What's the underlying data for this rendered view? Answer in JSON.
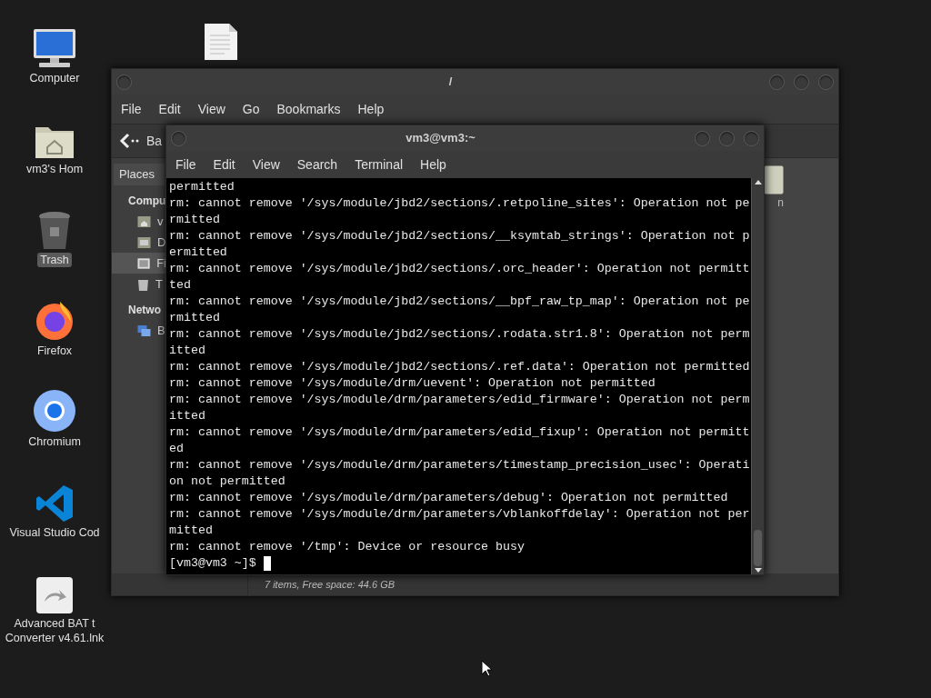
{
  "desktop_icons": [
    {
      "kind": "computer",
      "label": "Computer",
      "selected": false
    },
    {
      "kind": "home",
      "label": "vm3's Hom",
      "selected": false
    },
    {
      "kind": "trash",
      "label": "Trash",
      "selected": true
    },
    {
      "kind": "firefox",
      "label": "Firefox",
      "selected": false
    },
    {
      "kind": "chromium",
      "label": "Chromium",
      "selected": false
    },
    {
      "kind": "vscode",
      "label": "Visual Studio Cod",
      "selected": false
    },
    {
      "kind": "shortcut",
      "label": "Advanced BAT t\nConverter v4.61.lnk",
      "selected": false
    }
  ],
  "file_manager": {
    "title": "/",
    "menu": [
      "File",
      "Edit",
      "View",
      "Go",
      "Bookmarks",
      "Help"
    ],
    "back_button": "Ba",
    "sidebar_tab": "Places",
    "sections": [
      {
        "heading": "Compu",
        "items": [
          {
            "kind": "home",
            "label": "v",
            "selected": false
          },
          {
            "kind": "desktop",
            "label": "D",
            "selected": false
          },
          {
            "kind": "filesystem",
            "label": "Fi",
            "selected": true
          },
          {
            "kind": "trash",
            "label": "T",
            "selected": false
          }
        ]
      },
      {
        "heading": "Netwo",
        "items": [
          {
            "kind": "network",
            "label": "B",
            "selected": false
          }
        ]
      }
    ],
    "files": [
      {
        "label": "n"
      }
    ],
    "status": "7 items, Free space: 44.6 GB"
  },
  "terminal": {
    "title": "vm3@vm3:~",
    "menu": [
      "File",
      "Edit",
      "View",
      "Search",
      "Terminal",
      "Help"
    ],
    "lines": [
      "permitted",
      "rm: cannot remove '/sys/module/jbd2/sections/.retpoline_sites': Operation not pe",
      "rmitted",
      "rm: cannot remove '/sys/module/jbd2/sections/__ksymtab_strings': Operation not p",
      "ermitted",
      "rm: cannot remove '/sys/module/jbd2/sections/.orc_header': Operation not permitt",
      "ted",
      "rm: cannot remove '/sys/module/jbd2/sections/__bpf_raw_tp_map': Operation not pe",
      "rmitted",
      "rm: cannot remove '/sys/module/jbd2/sections/.rodata.str1.8': Operation not perm",
      "itted",
      "rm: cannot remove '/sys/module/jbd2/sections/.ref.data': Operation not permitted",
      "rm: cannot remove '/sys/module/drm/uevent': Operation not permitted",
      "rm: cannot remove '/sys/module/drm/parameters/edid_firmware': Operation not perm",
      "itted",
      "rm: cannot remove '/sys/module/drm/parameters/edid_fixup': Operation not permitt",
      "ed",
      "rm: cannot remove '/sys/module/drm/parameters/timestamp_precision_usec': Operati",
      "on not permitted",
      "rm: cannot remove '/sys/module/drm/parameters/debug': Operation not permitted",
      "rm: cannot remove '/sys/module/drm/parameters/vblankoffdelay': Operation not per",
      "mitted",
      "rm: cannot remove '/tmp': Device or resource busy"
    ],
    "prompt": "[vm3@vm3 ~]$ "
  }
}
